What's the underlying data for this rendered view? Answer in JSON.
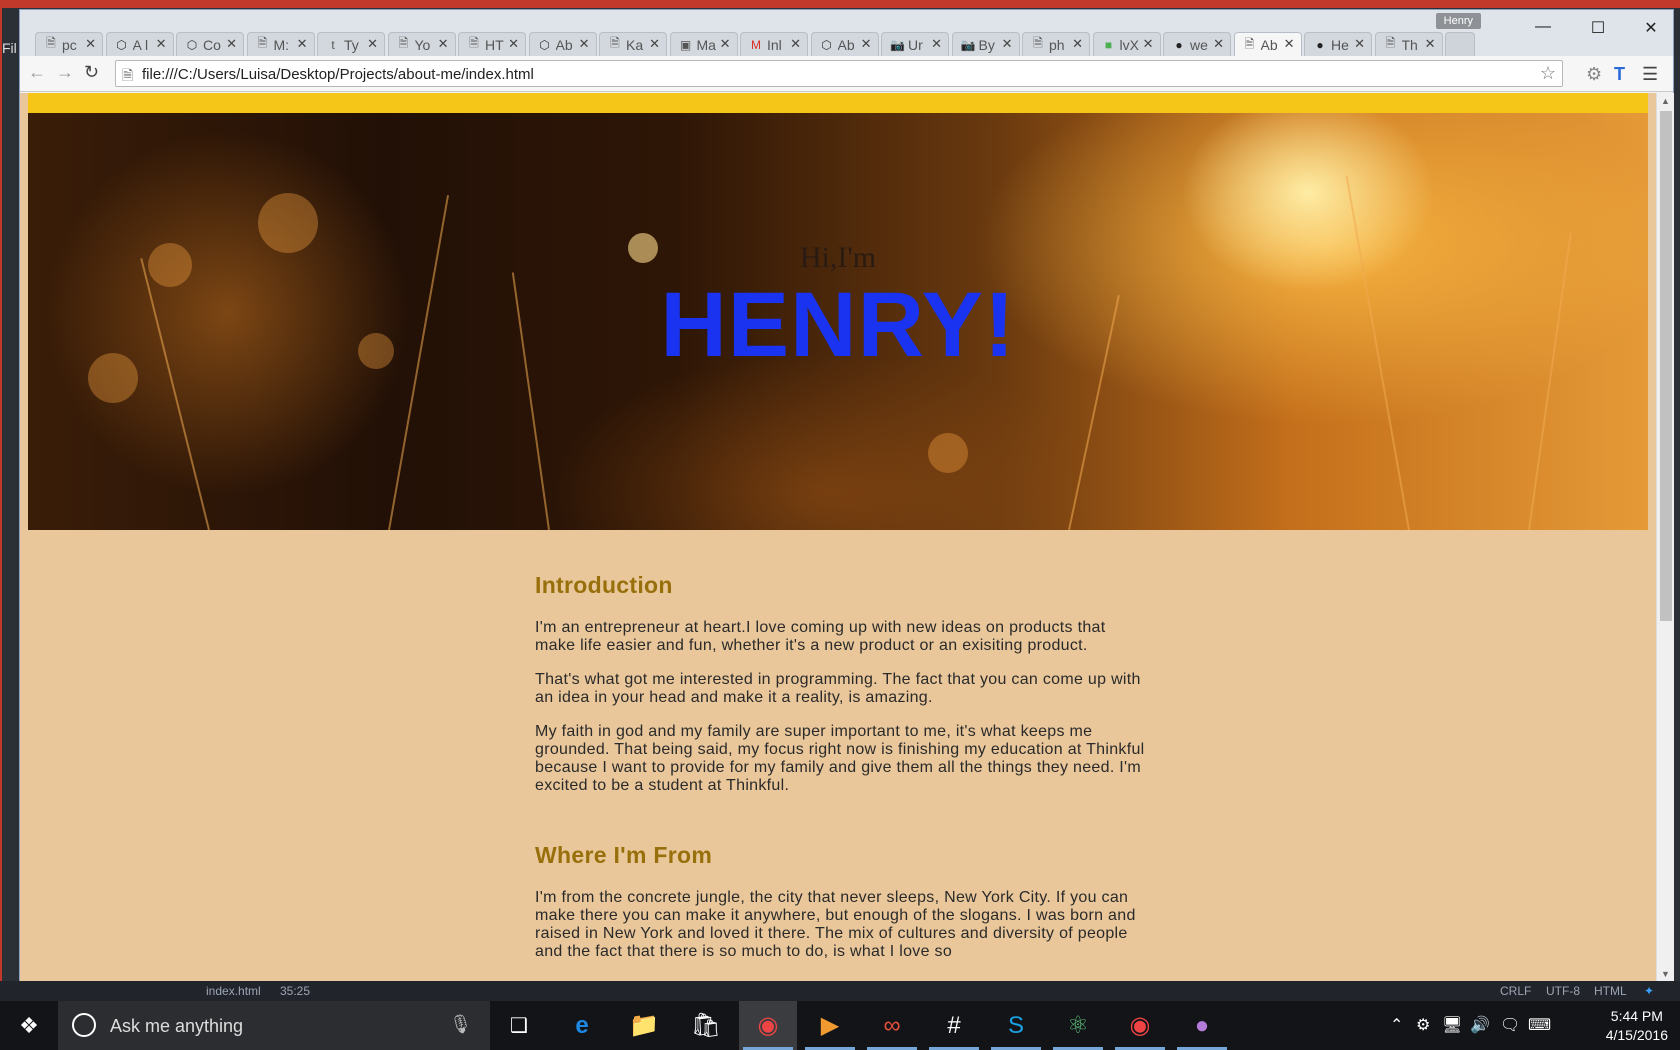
{
  "editor": {
    "menu_fragment": "Fil"
  },
  "browser": {
    "profile_name": "Henry",
    "tabs": [
      {
        "icon": "page",
        "label": "pc"
      },
      {
        "icon": "codepen",
        "label": "A l"
      },
      {
        "icon": "codepen",
        "label": "Co"
      },
      {
        "icon": "page",
        "label": "M:"
      },
      {
        "icon": "t",
        "label": "Ty"
      },
      {
        "icon": "page",
        "label": "Yo"
      },
      {
        "icon": "page",
        "label": "HT"
      },
      {
        "icon": "codepen",
        "label": "Ab"
      },
      {
        "icon": "page",
        "label": "Ka"
      },
      {
        "icon": "trello",
        "label": "Ma"
      },
      {
        "icon": "gmail",
        "label": "Inl"
      },
      {
        "icon": "codepen",
        "label": "Ab"
      },
      {
        "icon": "camera",
        "label": "Ur"
      },
      {
        "icon": "camera",
        "label": "By"
      },
      {
        "icon": "page",
        "label": "ph"
      },
      {
        "icon": "green",
        "label": "lvX"
      },
      {
        "icon": "github",
        "label": "we"
      },
      {
        "icon": "page",
        "label": "Ab",
        "active": true
      },
      {
        "icon": "github",
        "label": "He"
      },
      {
        "icon": "page",
        "label": "Th"
      }
    ],
    "url": "file:///C:/Users/Luisa/Desktop/Projects/about-me/index.html"
  },
  "page": {
    "hero": {
      "greeting": "Hi,I'm",
      "name": "HENRY!"
    },
    "sections": [
      {
        "heading": "Introduction",
        "paragraphs": [
          "I'm an entrepreneur at heart.I love coming up with new ideas on products that make life easier and fun, whether it's a new product or an exisiting product.",
          "That's what got me interested in programming. The fact that you can come up with an idea in your head and make it a reality, is amazing.",
          "My faith in god and my family are super important to me, it's what keeps me grounded. That being said, my focus right now is finishing my education at Thinkful because I want to provide for my family and give them all the things they need. I'm excited to be a student at Thinkful."
        ]
      },
      {
        "heading": "Where I'm From",
        "paragraphs": [
          "I'm from the concrete jungle, the city that never sleeps, New York City. If you can make there you can make it anywhere, but enough of the slogans. I was born and raised in New York and loved it there. The mix of cultures and diversity of people and the fact that there is so much to do, is what I love so"
        ]
      }
    ]
  },
  "atom_status": {
    "file": "index.html",
    "cursor": "35:25",
    "line_ending": "CRLF",
    "encoding": "UTF-8",
    "grammar": "HTML"
  },
  "taskbar": {
    "search_placeholder": "Ask me anything",
    "time": "5:44 PM",
    "date": "4/15/2016"
  }
}
